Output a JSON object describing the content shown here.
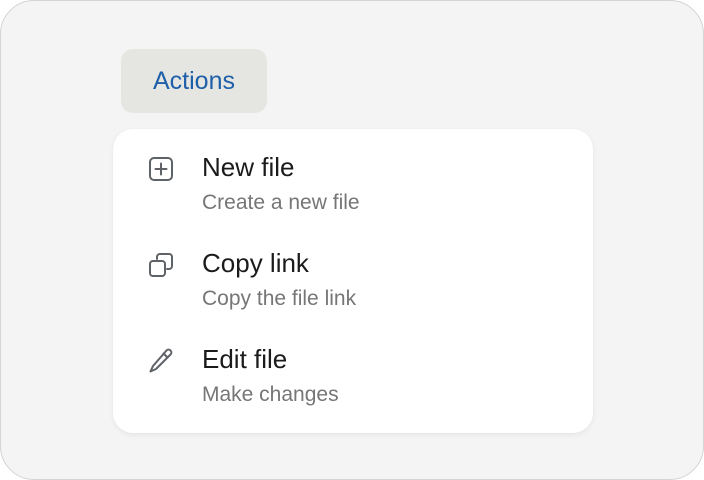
{
  "trigger": {
    "label": "Actions"
  },
  "menu": {
    "items": [
      {
        "title": "New file",
        "description": "Create a new file",
        "icon": "plus-square-icon"
      },
      {
        "title": "Copy link",
        "description": "Copy the file link",
        "icon": "copy-icon"
      },
      {
        "title": "Edit file",
        "description": "Make changes",
        "icon": "pencil-icon"
      }
    ]
  },
  "colors": {
    "accent": "#1d5fa8",
    "trigger_bg": "#e5e5e1",
    "title_text": "#1b1b1b",
    "description_text": "#767676"
  }
}
